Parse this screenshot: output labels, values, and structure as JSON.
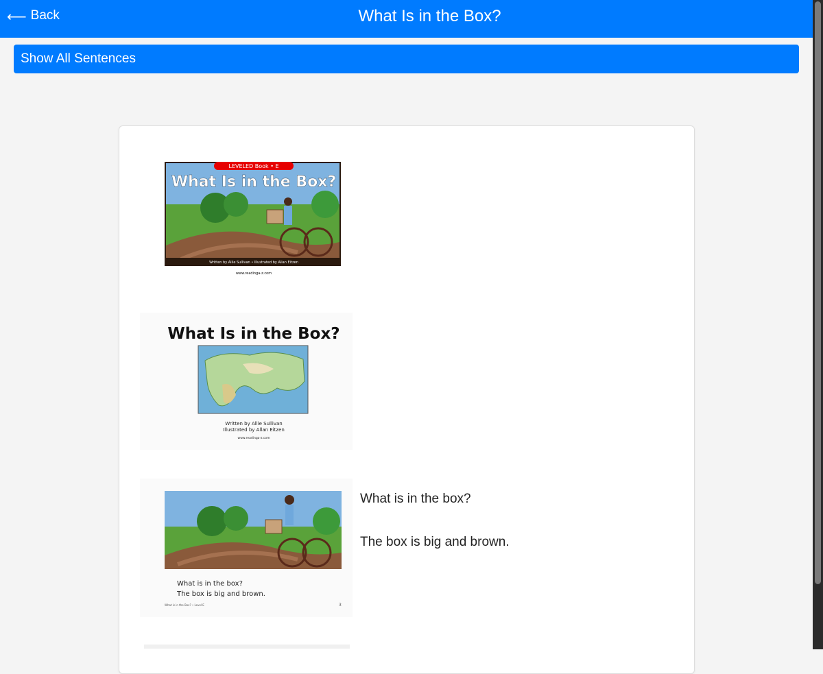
{
  "header": {
    "back_arrow": "⟵",
    "back_label": "Back",
    "title": "What Is in the Box?"
  },
  "toolbar": {
    "show_all_label": "Show All Sentences"
  },
  "pages": [
    {
      "kind": "cover",
      "banner": "LEVELED Book • E",
      "title": "What Is in the Box?",
      "credits": "Written by Allie Sullivan • Illustrated by Allan Eitzen",
      "url": "www.readinga-z.com"
    },
    {
      "kind": "title-page",
      "title": "What Is in the Box?",
      "author": "Written by Allie Sullivan",
      "illustrator": "Illustrated by Allan Eitzen",
      "url": "www.readinga-z.com"
    },
    {
      "kind": "story-page",
      "caption_1": "What is in the box?",
      "caption_2": "The box is big and brown.",
      "footer": "What is in the Box? • Level E",
      "page_number": "3",
      "sentences": [
        "What is in the box?",
        "The box is big and brown."
      ]
    }
  ],
  "colors": {
    "accent": "#007bff",
    "background": "#f4f4f4"
  }
}
